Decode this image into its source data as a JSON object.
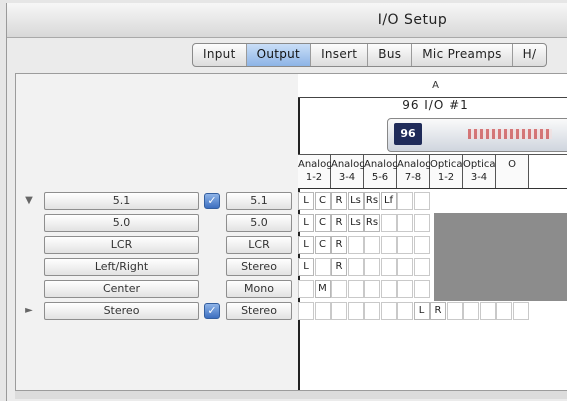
{
  "window": {
    "title": "I/O Setup"
  },
  "tabs": [
    "Input",
    "Output",
    "Insert",
    "Bus",
    "Mic Preamps",
    "H/"
  ],
  "active_tab": "Output",
  "section_label": "A",
  "device": {
    "name": "96 I/O #1",
    "badge": "96"
  },
  "columns": [
    [
      "Analog",
      "1-2"
    ],
    [
      "Analog",
      "3-4"
    ],
    [
      "Analog",
      "5-6"
    ],
    [
      "Analog",
      "7-8"
    ],
    [
      "Optical",
      "1-2"
    ],
    [
      "Optical",
      "3-4"
    ],
    [
      "O",
      ""
    ]
  ],
  "rows": [
    {
      "arrow": "▼",
      "name": "5.1",
      "checked": true,
      "format": "5.1",
      "cells": [
        "L",
        "C",
        "R",
        "Ls",
        "Rs",
        "Lf",
        "",
        "",
        "",
        "",
        "",
        "",
        "",
        ""
      ]
    },
    {
      "arrow": "",
      "name": "5.0",
      "checked": false,
      "format": "5.0",
      "cells": [
        "L",
        "C",
        "R",
        "Ls",
        "Rs",
        "",
        "",
        "",
        "",
        "",
        "",
        "",
        "",
        ""
      ]
    },
    {
      "arrow": "",
      "name": "LCR",
      "checked": false,
      "format": "LCR",
      "cells": [
        "L",
        "C",
        "R",
        "",
        "",
        "",
        "",
        "",
        "",
        "",
        "",
        "",
        "",
        ""
      ]
    },
    {
      "arrow": "",
      "name": "Left/Right",
      "checked": false,
      "format": "Stereo",
      "cells": [
        "L",
        "",
        "R",
        "",
        "",
        "",
        "",
        "",
        "",
        "",
        "",
        "",
        "",
        ""
      ]
    },
    {
      "arrow": "",
      "name": "Center",
      "checked": false,
      "format": "Mono",
      "cells": [
        "",
        "M",
        "",
        "",
        "",
        "",
        "",
        "",
        "",
        "",
        "",
        "",
        "",
        ""
      ]
    },
    {
      "arrow": "►",
      "name": "Stereo",
      "checked": true,
      "format": "Stereo",
      "cells": [
        "",
        "",
        "",
        "",
        "",
        "",
        "",
        "L",
        "R",
        "",
        "",
        "",
        "",
        ""
      ]
    }
  ],
  "colors": {
    "accent": "#3c6fc0",
    "shade": "#8c8c8c"
  }
}
